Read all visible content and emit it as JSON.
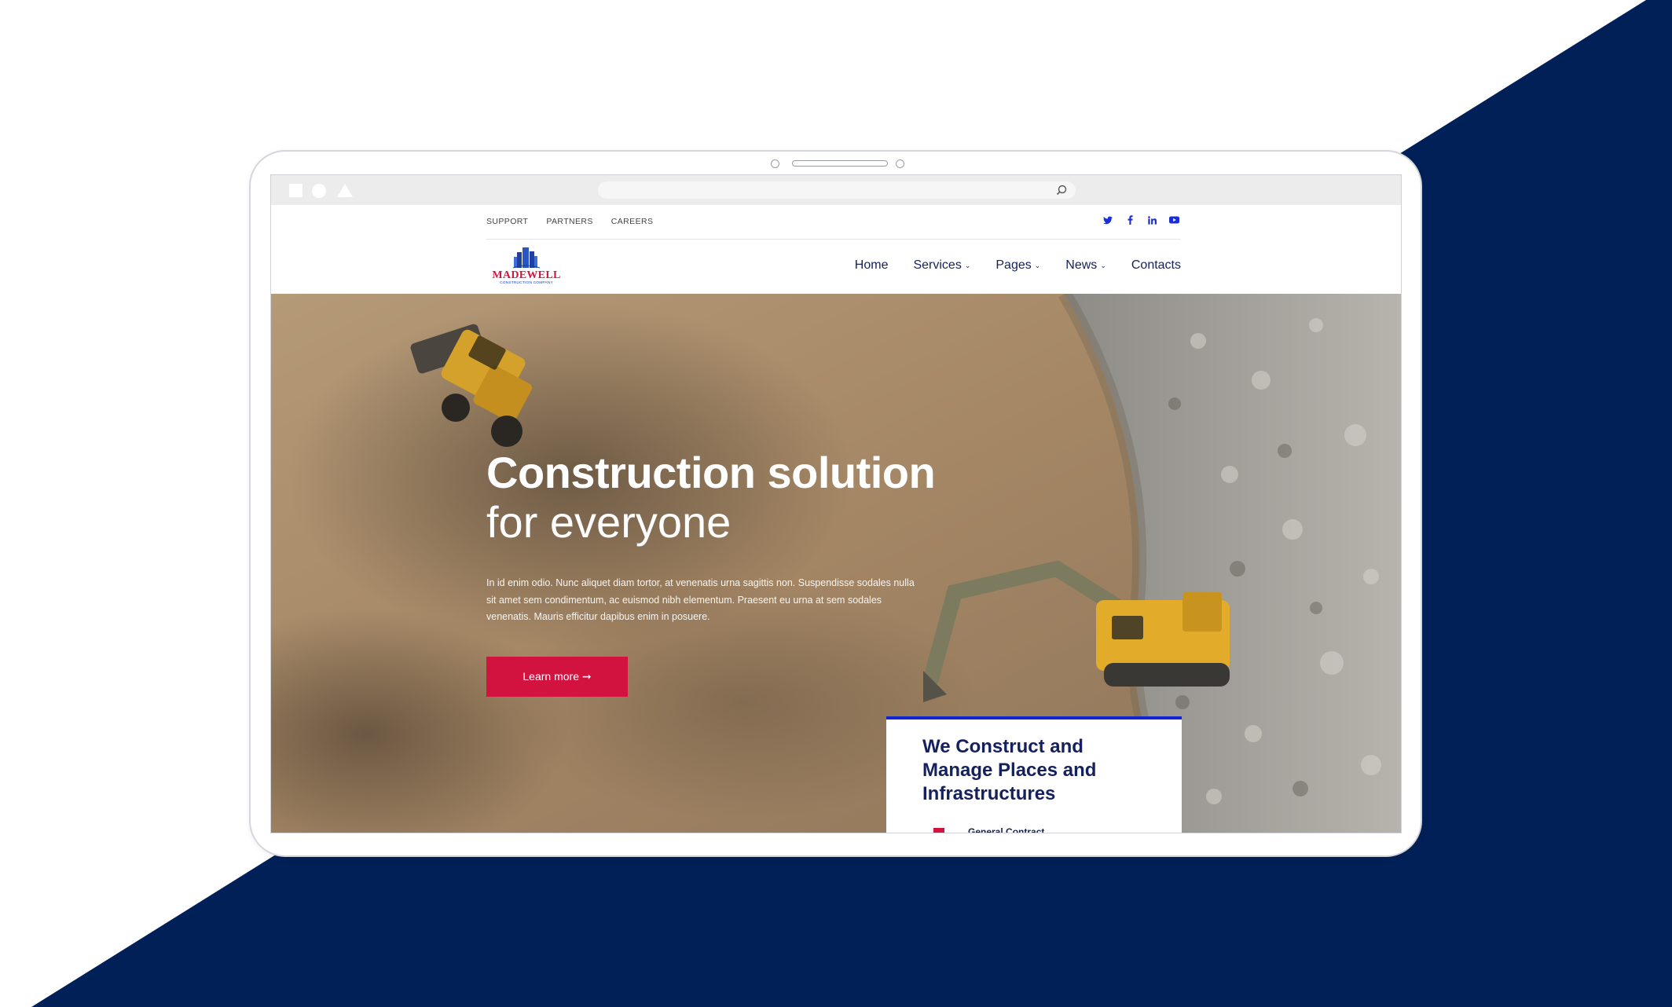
{
  "theme": {
    "navy": "#001f5c",
    "accent_red": "#d3133f",
    "accent_blue": "#1126d2",
    "text_navy": "#14215c"
  },
  "browser": {
    "address_placeholder": "",
    "icons": [
      "square-icon",
      "circle-icon",
      "triangle-icon",
      "search-icon"
    ]
  },
  "topbar": {
    "links": [
      "SUPPORT",
      "PARTNERS",
      "CAREERS"
    ],
    "social_icons": [
      "twitter-icon",
      "facebook-icon",
      "linkedin-icon",
      "youtube-icon"
    ]
  },
  "logo": {
    "word": "Madewell",
    "sub": "Construction Company"
  },
  "nav": {
    "home": "Home",
    "services": "Services",
    "pages": "Pages",
    "news": "News",
    "contacts": "Contacts"
  },
  "hero": {
    "title_line1": "Construction solution",
    "title_line2": "for everyone",
    "paragraph": "In id enim odio. Nunc aliquet diam tortor, at venenatis urna sagittis non. Suspendisse sodales nulla sit amet sem condimentum, ac euismod nibh elementum. Praesent eu urna at sem sodales venenatis. Mauris efficitur dapibus enim in posuere.",
    "button": "Learn more ➞"
  },
  "card": {
    "title": "We Construct and Manage Places and Infrastructures",
    "item": "General Contract"
  }
}
